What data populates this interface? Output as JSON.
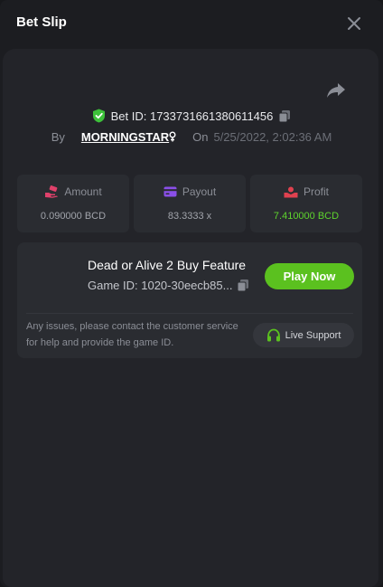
{
  "header": {
    "title": "Bet Slip"
  },
  "bet": {
    "id_label": "Bet ID: 1733731661380611456",
    "by_label": "By",
    "user": "MORNINGSTAR",
    "on_label": "On",
    "date": "5/25/2022, 2:02:36 AM"
  },
  "stats": {
    "amount": {
      "label": "Amount",
      "value": "0.090000 BCD"
    },
    "payout": {
      "label": "Payout",
      "value": "83.3333 x"
    },
    "profit": {
      "label": "Profit",
      "value": "7.410000 BCD"
    }
  },
  "game": {
    "title": "Dead or Alive 2 Buy Feature",
    "id_label": "Game ID: 1020-30eecb85...",
    "play_label": "Play Now",
    "issues_text": "Any issues, please contact the customer service for help and provide the game ID.",
    "support_label": "Live Support"
  },
  "colors": {
    "accent_green": "#5bc11f",
    "profit_green": "#5ed42d",
    "amount_icon": "#e0416b",
    "payout_icon": "#8a4fe8",
    "profit_icon": "#e0414f"
  },
  "icons": [
    "close-icon",
    "share-icon",
    "shield-check-icon",
    "copy-icon",
    "gender-icon",
    "hand-money-icon",
    "wallet-icon",
    "hands-profit-icon",
    "headset-icon"
  ]
}
